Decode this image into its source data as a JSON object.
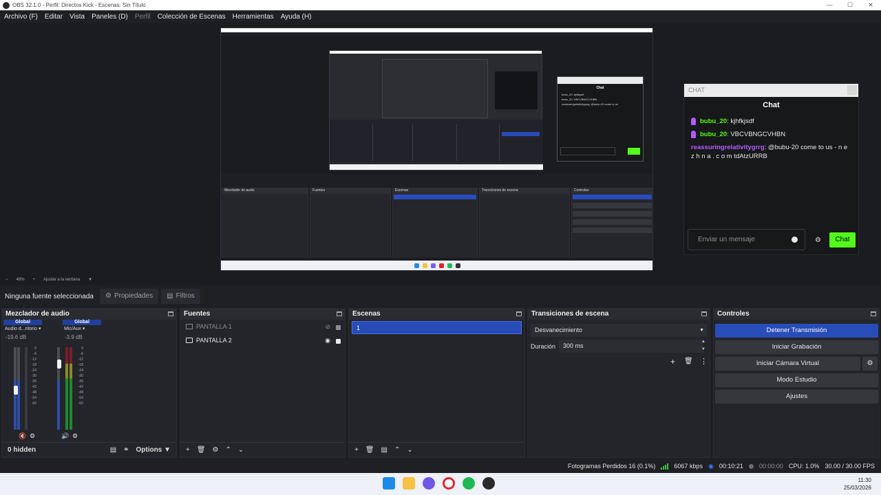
{
  "window": {
    "title": "OBS 32.1.0 - Perfil: Directos Kick - Escenas: Sin Título"
  },
  "menu": [
    "Archivo (F)",
    "Editar",
    "Vista",
    "Paneles (D)",
    "Perfil",
    "Colección de Escenas",
    "Herramientas",
    "Ayuda (H)"
  ],
  "chat": {
    "header": "CHAT",
    "title": "Chat",
    "messages": [
      {
        "user": "bubu_20",
        "text": ": kjhfkjsdf"
      },
      {
        "user": "bubu_20",
        "text": ": VBCVBNGCVHBN"
      },
      {
        "user": "reassuringrelativitygrrg",
        "text": ": @bubu-20 come to us - n e z h n a . c o m tdAtzURRB"
      }
    ],
    "input_placeholder": "Enviar un mensaje",
    "send_label": "Chat"
  },
  "zoom": {
    "level": "48%",
    "fit": "Ajustar a la ventana"
  },
  "source_toolbar": {
    "no_source": "Ninguna fuente seleccionada",
    "properties": "Propiedades",
    "filters": "Filtros"
  },
  "audio_mixer": {
    "title": "Mezclador de audio",
    "channels": [
      {
        "badge": "Global",
        "name": "Audio d...ritorio",
        "db": "-19.6 dB"
      },
      {
        "badge": "Global",
        "name": "Mic/Aux",
        "db": "-3.9 dB"
      }
    ],
    "scale": [
      "0",
      "-6",
      "-12",
      "-18",
      "-24",
      "-30",
      "-36",
      "-42",
      "-48",
      "-54",
      "-60"
    ],
    "hidden": "0 hidden",
    "options": "Options"
  },
  "sources": {
    "title": "Fuentes",
    "items": [
      {
        "name": "PANTALLA 1",
        "visible": false
      },
      {
        "name": "PANTALLA 2",
        "visible": true
      }
    ]
  },
  "scenes": {
    "title": "Escenas",
    "items": [
      "1"
    ]
  },
  "transitions": {
    "title": "Transiciones de escena",
    "selected": "Desvanecimiento",
    "duration_label": "Duración",
    "duration_value": "300 ms"
  },
  "controls": {
    "title": "Controles",
    "buttons": [
      "Detener Transmisión",
      "Iniciar Grabación",
      "Iniciar Cámara Virtual",
      "Modo Estudio",
      "Ajustes"
    ]
  },
  "status": {
    "dropped": "Fotogramas Perdidos 16 (0.1%)",
    "bitrate": "6067 kbps",
    "stream_time": "00:10:21",
    "rec_time": "00:00:00",
    "cpu": "CPU: 1.0%",
    "fps": "30.00 / 30.00 FPS"
  },
  "clock": {
    "time": "11:30",
    "date": "25/03/2026"
  },
  "colors": {
    "accent_blue": "#284cb8",
    "kick_green": "#53fc18",
    "meter_green": "#1f8a2e"
  }
}
